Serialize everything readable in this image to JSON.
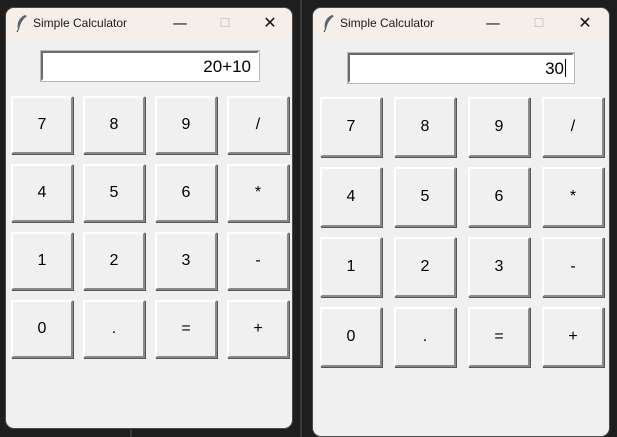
{
  "windows": [
    {
      "title": "Simple Calculator",
      "display_value": "20+10",
      "controls": {
        "minimize": "—",
        "maximize": "☐",
        "close": "✕"
      },
      "buttons": [
        "7",
        "8",
        "9",
        "/",
        "4",
        "5",
        "6",
        "*",
        "1",
        "2",
        "3",
        "-",
        "0",
        ".",
        "=",
        "+"
      ]
    },
    {
      "title": "Simple Calculator",
      "display_value": "30",
      "controls": {
        "minimize": "—",
        "maximize": "☐",
        "close": "✕"
      },
      "buttons": [
        "7",
        "8",
        "9",
        "/",
        "4",
        "5",
        "6",
        "*",
        "1",
        "2",
        "3",
        "-",
        "0",
        ".",
        "=",
        "+"
      ]
    }
  ],
  "icons": {
    "app": "feather-icon"
  }
}
